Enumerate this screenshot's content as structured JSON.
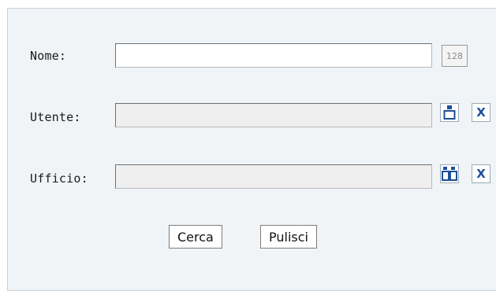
{
  "form": {
    "nome": {
      "label": "Nome:",
      "value": "",
      "counter": "128"
    },
    "utente": {
      "label": "Utente:",
      "value": "",
      "lookup_icon": "single-user-icon",
      "clear_label": "X"
    },
    "ufficio": {
      "label": "Ufficio:",
      "value": "",
      "lookup_icon": "group-users-icon",
      "clear_label": "X"
    }
  },
  "actions": {
    "search_label": "Cerca",
    "clear_label": "Pulisci"
  },
  "colors": {
    "panel_background": "#f0f4f7",
    "panel_border": "#c6d2dc",
    "icon_blue": "#1d4f9a"
  }
}
